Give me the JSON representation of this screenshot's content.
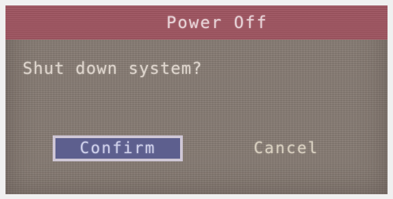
{
  "dialog": {
    "title": "Power Off",
    "message": "Shut down system?",
    "buttons": {
      "confirm_label": "Confirm",
      "cancel_label": "Cancel"
    },
    "selected_button": "confirm"
  },
  "colors": {
    "title_bar": "#a05662",
    "dialog_body": "#8a7f77",
    "selected_button": "#5d5f8e",
    "selected_border": "#cfc7d6"
  }
}
